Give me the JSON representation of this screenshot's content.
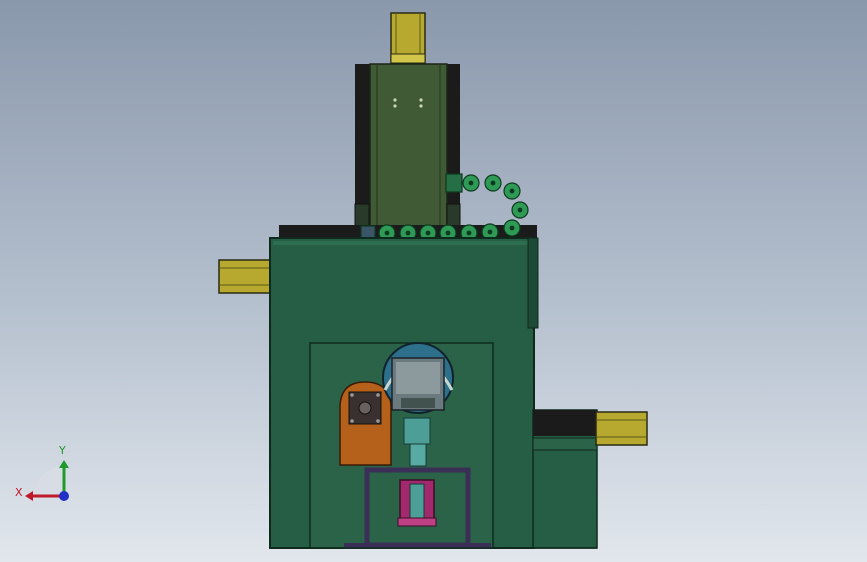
{
  "view": {
    "background_top": "#8a98ac",
    "background_bottom": "#e2e7ed"
  },
  "colors": {
    "body_green": "#255e45",
    "dark_green": "#1d4a36",
    "olive_column": "#3f5a34",
    "yellow_rail": "#b7a92f",
    "chain_green": "#2e9a55",
    "orange_plate": "#b5611c",
    "magenta_part": "#a3296f",
    "purple_frame": "#3b2f57",
    "cyan_part": "#4d9e97",
    "black_base": "#1b1b1b"
  },
  "triad": {
    "x_label": "X",
    "y_label": "Y",
    "x_color": "#c0192a",
    "y_color": "#1f9a2d",
    "z_color": "#2230c8"
  }
}
